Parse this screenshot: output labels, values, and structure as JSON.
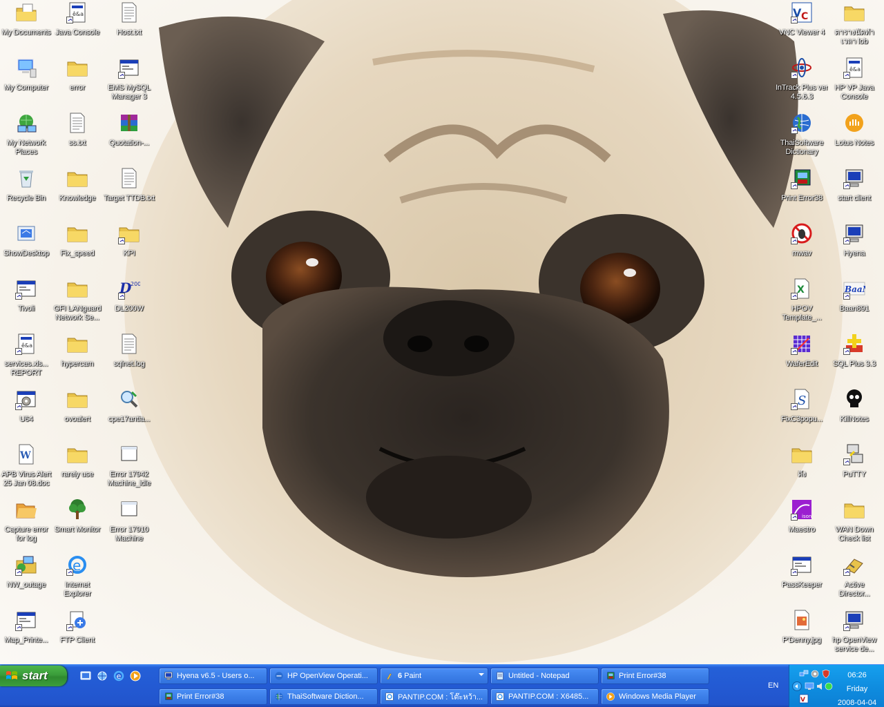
{
  "desktop": {
    "columns": [
      [
        {
          "name": "my-documents-icon",
          "label": "My Documents",
          "icon": "folder-docs-icon",
          "shortcut": false
        },
        {
          "name": "my-computer-icon",
          "label": "My Computer",
          "icon": "computer-icon",
          "shortcut": false
        },
        {
          "name": "my-network-places-icon",
          "label": "My Network Places",
          "icon": "network-icon",
          "shortcut": false
        },
        {
          "name": "recycle-bin-icon",
          "label": "Recycle Bin",
          "icon": "recycle-bin-icon",
          "shortcut": false
        },
        {
          "name": "show-desktop-icon",
          "label": "ShowDesktop",
          "icon": "show-desktop-icon",
          "shortcut": false
        },
        {
          "name": "tivoli-icon",
          "label": "Tivoli",
          "icon": "window-app-icon",
          "shortcut": true
        },
        {
          "name": "services-report-icon",
          "label": "services.xls... REPORT",
          "icon": "document-app-icon",
          "shortcut": true
        },
        {
          "name": "u64-icon",
          "label": "U64",
          "icon": "gear-app-icon",
          "shortcut": true
        },
        {
          "name": "apb-virus-alert-icon",
          "label": "APB Virus Alert 25 Jan 08.doc",
          "icon": "word-doc-icon",
          "shortcut": false
        },
        {
          "name": "capture-error-for-log-icon",
          "label": "Capture error for log",
          "icon": "folder-open-icon",
          "shortcut": false
        },
        {
          "name": "nw-outage-icon",
          "label": "NW_outage",
          "icon": "network-folder-icon",
          "shortcut": true
        },
        {
          "name": "map-printer-icon",
          "label": "Map_Printe...",
          "icon": "window-app-icon",
          "shortcut": true
        }
      ],
      [
        {
          "name": "java-console-icon",
          "label": "Java Console",
          "icon": "document-app-icon",
          "shortcut": true
        },
        {
          "name": "error-folder-icon",
          "label": "error",
          "icon": "folder-icon",
          "shortcut": false
        },
        {
          "name": "ss-txt-icon",
          "label": "ss.txt",
          "icon": "text-file-icon",
          "shortcut": false
        },
        {
          "name": "knowledge-folder-icon",
          "label": "Knowledge",
          "icon": "folder-icon",
          "shortcut": false
        },
        {
          "name": "fix-speed-folder-icon",
          "label": "Fix_speed",
          "icon": "folder-icon",
          "shortcut": false
        },
        {
          "name": "gfi-languard-icon",
          "label": "GFI LANguard Network Se...",
          "icon": "folder-icon",
          "shortcut": false
        },
        {
          "name": "hypercam-folder-icon",
          "label": "hypercam",
          "icon": "folder-icon",
          "shortcut": false
        },
        {
          "name": "ovoalert-folder-icon",
          "label": "ovoalert",
          "icon": "folder-icon",
          "shortcut": false
        },
        {
          "name": "rarely-use-folder-icon",
          "label": "rarely use",
          "icon": "folder-icon",
          "shortcut": false
        },
        {
          "name": "smart-monitor-icon",
          "label": "Smart Monitor",
          "icon": "tree-icon",
          "shortcut": false
        },
        {
          "name": "internet-explorer-icon",
          "label": "Internet Explorer",
          "icon": "ie-icon",
          "shortcut": true
        },
        {
          "name": "ftp-client-icon",
          "label": "FTP Client",
          "icon": "ftp-icon",
          "shortcut": true
        }
      ],
      [
        {
          "name": "host-txt-icon",
          "label": "Host.txt",
          "icon": "text-file-icon",
          "shortcut": false
        },
        {
          "name": "ems-mysql-manager-icon",
          "label": "EMS MySQL Manager 3",
          "icon": "window-app-icon",
          "shortcut": true
        },
        {
          "name": "quotation-icon",
          "label": "Quotation-...",
          "icon": "winrar-icon",
          "shortcut": false
        },
        {
          "name": "target-ttdb-txt-icon",
          "label": "Target TTDB.txt",
          "icon": "text-file-icon",
          "shortcut": false
        },
        {
          "name": "kpi-folder-icon",
          "label": "KPI",
          "icon": "folder-icon",
          "shortcut": true
        },
        {
          "name": "dl200w-icon",
          "label": "DL200W",
          "icon": "dl200-icon",
          "shortcut": true
        },
        {
          "name": "sqlnet-log-icon",
          "label": "sqlnet.log",
          "icon": "text-file-icon",
          "shortcut": false
        },
        {
          "name": "cpe17antia-icon",
          "label": "cpe17antia...",
          "icon": "magnifier-icon",
          "shortcut": false
        },
        {
          "name": "error-17942-icon",
          "label": "Error 17942 Machine_idle",
          "icon": "blank-window-icon",
          "shortcut": false
        },
        {
          "name": "error-17910-icon",
          "label": "Error 17910 Machine",
          "icon": "blank-window-icon",
          "shortcut": false
        }
      ],
      [
        {
          "name": "vnc-viewer-icon",
          "label": "VNC Viewer 4",
          "icon": "vnc-icon",
          "shortcut": true
        },
        {
          "name": "intrack-plus-icon",
          "label": "InTrack Plus ver 4.5.6.3",
          "icon": "atom-icon",
          "shortcut": true
        },
        {
          "name": "thaisoftware-dictionary-icon",
          "label": "ThaiSoftware Dictionary",
          "icon": "globe-icon",
          "shortcut": true
        },
        {
          "name": "print-error38-icon",
          "label": "Print Error38",
          "icon": "printer-app-icon",
          "shortcut": true
        },
        {
          "name": "mwav-icon",
          "label": "mwav",
          "icon": "no-bug-icon",
          "shortcut": true
        },
        {
          "name": "hpov-template-icon",
          "label": "HPOV Template_...",
          "icon": "excel-icon",
          "shortcut": true
        },
        {
          "name": "waferedit-icon",
          "label": "WaferEdit",
          "icon": "grid-app-icon",
          "shortcut": true
        },
        {
          "name": "fixc3populate-icon",
          "label": "FixC3popu...",
          "icon": "script-icon",
          "shortcut": true
        },
        {
          "name": "thai-folder-icon",
          "label": "ดึง",
          "icon": "folder-icon",
          "shortcut": false
        },
        {
          "name": "maestro-icon",
          "label": "Maestro",
          "icon": "maestro-icon",
          "shortcut": true
        },
        {
          "name": "passkeeper-icon",
          "label": "PassKeeper",
          "icon": "window-app-icon",
          "shortcut": true
        },
        {
          "name": "p-denny-jpg-icon",
          "label": "P'Denny.jpg",
          "icon": "image-file-icon",
          "shortcut": false
        }
      ],
      [
        {
          "name": "thai-folder-2-icon",
          "label": "ตารางนัดทำ เวลา lob",
          "icon": "folder-icon",
          "shortcut": false
        },
        {
          "name": "hp-vp-java-console-icon",
          "label": "HP VP Java Console",
          "icon": "document-app-icon",
          "shortcut": true
        },
        {
          "name": "lotus-notes-icon",
          "label": "Lotus Notes",
          "icon": "lotus-icon",
          "shortcut": false
        },
        {
          "name": "start-client-icon",
          "label": "start client",
          "icon": "monitor-app-icon",
          "shortcut": true
        },
        {
          "name": "hyena-icon",
          "label": "Hyena",
          "icon": "monitor-app-icon",
          "shortcut": true
        },
        {
          "name": "baan891-icon",
          "label": "Baan891",
          "icon": "baan-icon",
          "shortcut": true
        },
        {
          "name": "sql-plus-icon",
          "label": "SQL Plus 3.3",
          "icon": "sqlplus-icon",
          "shortcut": true
        },
        {
          "name": "killnotes-icon",
          "label": "KillNotes",
          "icon": "skull-icon",
          "shortcut": false
        },
        {
          "name": "putty-icon",
          "label": "PuTTY",
          "icon": "putty-icon",
          "shortcut": true
        },
        {
          "name": "wan-down-checklist-icon",
          "label": "WAN Down Check list",
          "icon": "folder-icon",
          "shortcut": false
        },
        {
          "name": "active-directory-icon",
          "label": "Active Director...",
          "icon": "ad-icon",
          "shortcut": true
        },
        {
          "name": "hp-openview-service-icon",
          "label": "hp OpenView service de...",
          "icon": "monitor-app-icon",
          "shortcut": true
        }
      ]
    ]
  },
  "taskbar": {
    "start_label": "start",
    "quicklaunch": [
      "show-desktop-icon",
      "network-icon",
      "ie-icon",
      "media-icon"
    ],
    "tasks": [
      {
        "label": "Hyena v6.5 - Users o...",
        "icon": "monitor-app-icon"
      },
      {
        "label": "HP OpenView Operati...",
        "icon": "openview-icon"
      },
      {
        "label": "Paint",
        "count": "6",
        "icon": "paint-icon",
        "group": true
      },
      {
        "label": "Untitled - Notepad",
        "icon": "notepad-icon"
      },
      {
        "label": "Print Error#38",
        "icon": "printer-app-icon"
      },
      {
        "label": "Print Error#38",
        "icon": "printer-app-icon"
      },
      {
        "label": "ThaiSoftware Diction...",
        "icon": "globe-icon"
      },
      {
        "label": "PANTIP.COM : โต๊ะหว้า...",
        "icon": "ie-page-icon"
      },
      {
        "label": "PANTIP.COM : X6485...",
        "icon": "ie-page-icon"
      },
      {
        "label": "Windows Media Player",
        "icon": "media-icon"
      }
    ],
    "language": "EN",
    "clock": {
      "time": "06:26",
      "day": "Friday",
      "date": "2008-04-04"
    }
  },
  "colors": {
    "taskbar_blue": "#235ad3",
    "start_green": "#3a9c3a",
    "tray_blue": "#0f8de0",
    "task_button": "#3c7fe8"
  }
}
